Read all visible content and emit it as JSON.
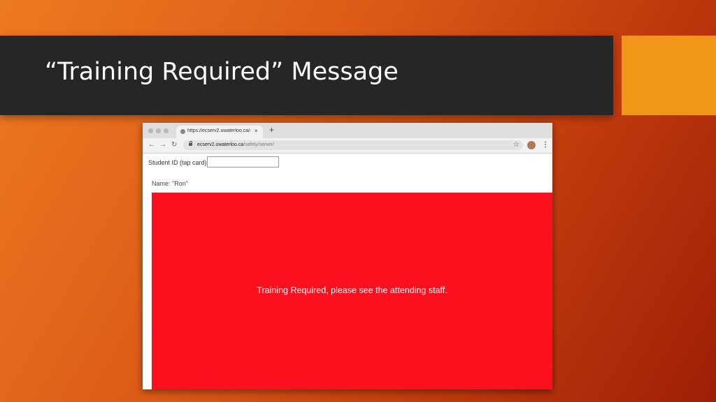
{
  "slide": {
    "title": "“Training Required” Message",
    "colors": {
      "title_bar": "#262626",
      "accent": "#f2961a",
      "background": "#dd5a16"
    }
  },
  "browser": {
    "tab": {
      "title": "https://ecserv2.uwaterloo.ca/sa",
      "close": "×",
      "favicon": "globe-icon"
    },
    "new_tab": "+",
    "nav": {
      "back": "←",
      "forward": "→",
      "reload": "↻"
    },
    "url": {
      "host": "ecserv2.uwaterloo.ca",
      "path": "/safety/server/"
    },
    "star": "☆",
    "menu": "⋮"
  },
  "page": {
    "student_id_label": "Student ID (tap card)",
    "student_id_value": "",
    "name_line": "Name:  \"Ron\"",
    "alert_message": "Training Required, please see the attending staff.",
    "alert_color": "#fc101e"
  }
}
